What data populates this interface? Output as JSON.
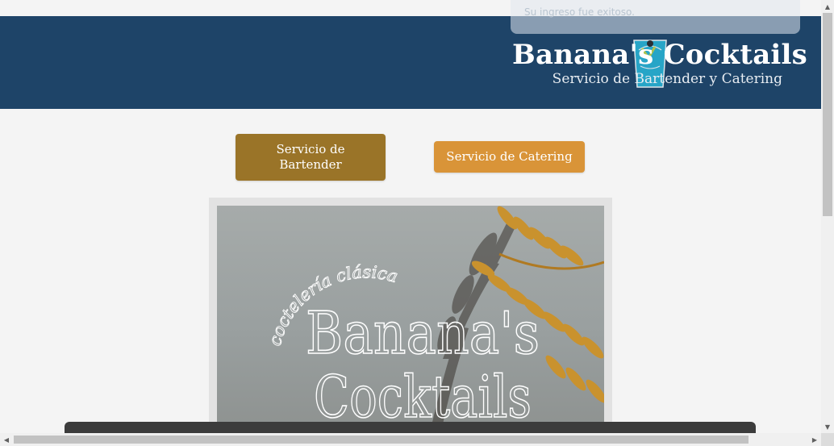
{
  "toast": {
    "message": "Su ingreso fue exitoso."
  },
  "header": {
    "title": "Banana's Cocktails",
    "subtitle": "Servicio de Bartender y Catering"
  },
  "services": {
    "bartender_label": "Servicio de Bartender",
    "catering_label": "Servicio de Catering"
  },
  "poster": {
    "arc_text": "coctelería clásica",
    "title_line1": "Banana's",
    "title_line2": "Cocktails"
  },
  "colors": {
    "header_bg": "#1e4468",
    "bartender_btn": "#9a7428",
    "catering_btn": "#d99438"
  }
}
